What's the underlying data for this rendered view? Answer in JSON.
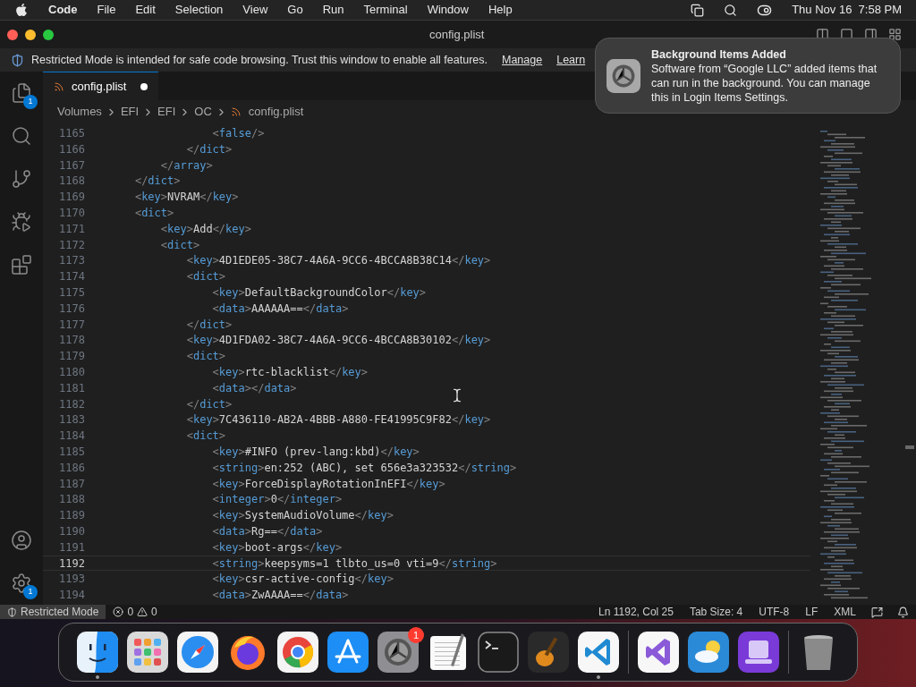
{
  "menu_bar": {
    "app": "Code",
    "items": [
      "File",
      "Edit",
      "Selection",
      "View",
      "Go",
      "Run",
      "Terminal",
      "Window",
      "Help"
    ],
    "clock": "Thu Nov 16  7:58 PM"
  },
  "window": {
    "title": "config.plist"
  },
  "banner": {
    "message": "Restricted Mode is intended for safe code browsing. Trust this window to enable all features.",
    "links": [
      "Manage",
      "Learn"
    ]
  },
  "activity_bar": {
    "top": [
      {
        "kind": "explorer",
        "badge": "1"
      },
      {
        "kind": "search"
      },
      {
        "kind": "scm"
      },
      {
        "kind": "debug"
      },
      {
        "kind": "extensions"
      }
    ],
    "bottom": [
      {
        "kind": "accounts"
      },
      {
        "kind": "manage",
        "badge": "1"
      }
    ]
  },
  "tabs": [
    {
      "label": "config.plist",
      "selected": true,
      "modified": true
    }
  ],
  "breadcrumb": [
    "Volumes",
    "EFI",
    "EFI",
    "OC",
    "config.plist"
  ],
  "editor": {
    "lines": [
      {
        "number": "1165",
        "text": "                <false/>",
        "current": false
      },
      {
        "number": "1166",
        "text": "            </dict>",
        "current": false
      },
      {
        "number": "1167",
        "text": "        </array>",
        "current": false
      },
      {
        "number": "1168",
        "text": "    </dict>",
        "current": false
      },
      {
        "number": "1169",
        "text": "    <key>NVRAM</key>",
        "current": false
      },
      {
        "number": "1170",
        "text": "    <dict>",
        "current": false
      },
      {
        "number": "1171",
        "text": "        <key>Add</key>",
        "current": false
      },
      {
        "number": "1172",
        "text": "        <dict>",
        "current": false
      },
      {
        "number": "1173",
        "text": "            <key>4D1EDE05-38C7-4A6A-9CC6-4BCCA8B38C14</key>",
        "current": false
      },
      {
        "number": "1174",
        "text": "            <dict>",
        "current": false
      },
      {
        "number": "1175",
        "text": "                <key>DefaultBackgroundColor</key>",
        "current": false
      },
      {
        "number": "1176",
        "text": "                <data>AAAAAA==</data>",
        "current": false
      },
      {
        "number": "1177",
        "text": "            </dict>",
        "current": false
      },
      {
        "number": "1178",
        "text": "            <key>4D1FDA02-38C7-4A6A-9CC6-4BCCA8B30102</key>",
        "current": false
      },
      {
        "number": "1179",
        "text": "            <dict>",
        "current": false
      },
      {
        "number": "1180",
        "text": "                <key>rtc-blacklist</key>",
        "current": false
      },
      {
        "number": "1181",
        "text": "                <data></data>",
        "current": false
      },
      {
        "number": "1182",
        "text": "            </dict>",
        "current": false
      },
      {
        "number": "1183",
        "text": "            <key>7C436110-AB2A-4BBB-A880-FE41995C9F82</key>",
        "current": false
      },
      {
        "number": "1184",
        "text": "            <dict>",
        "current": false
      },
      {
        "number": "1185",
        "text": "                <key>#INFO (prev-lang:kbd)</key>",
        "current": false
      },
      {
        "number": "1186",
        "text": "                <string>en:252 (ABC), set 656e3a323532</string>",
        "current": false
      },
      {
        "number": "1187",
        "text": "                <key>ForceDisplayRotationInEFI</key>",
        "current": false
      },
      {
        "number": "1188",
        "text": "                <integer>0</integer>",
        "current": false
      },
      {
        "number": "1189",
        "text": "                <key>SystemAudioVolume</key>",
        "current": false
      },
      {
        "number": "1190",
        "text": "                <data>Rg==</data>",
        "current": false
      },
      {
        "number": "1191",
        "text": "                <key>boot-args</key>",
        "current": false
      },
      {
        "number": "1192",
        "text": "                <string>keepsyms=1 tlbto_us=0 vti=9</string>",
        "current": true
      },
      {
        "number": "1193",
        "text": "                <key>csr-active-config</key>",
        "current": false
      },
      {
        "number": "1194",
        "text": "                <data>ZwAAAA==</data>",
        "current": false
      }
    ]
  },
  "status_bar": {
    "mode": "Restricted Mode",
    "errors": "0",
    "warnings": "0",
    "right": [
      "Ln 1192, Col 25",
      "Tab Size: 4",
      "UTF-8",
      "LF",
      "XML"
    ]
  },
  "notification": {
    "title": "Background Items Added",
    "body": "Software from “Google LLC” added items that can run in the background. You can manage this in Login Items Settings."
  },
  "dock": {
    "apps": [
      {
        "kind": "finder",
        "running": true
      },
      {
        "kind": "launchpad",
        "running": false
      },
      {
        "kind": "safari",
        "running": false
      },
      {
        "kind": "firefox",
        "running": false
      },
      {
        "kind": "chrome",
        "running": false
      },
      {
        "kind": "appstore",
        "running": false
      },
      {
        "kind": "settings",
        "running": false,
        "badge": "1"
      },
      {
        "kind": "textedit",
        "running": false
      },
      {
        "kind": "terminal",
        "running": false
      },
      {
        "kind": "garageband",
        "running": false
      },
      {
        "kind": "vscode",
        "running": true
      },
      {
        "kind": "separator"
      },
      {
        "kind": "visualstudio",
        "running": false
      },
      {
        "kind": "weather",
        "running": false
      },
      {
        "kind": "configurator",
        "running": false
      },
      {
        "kind": "separator"
      },
      {
        "kind": "trash",
        "running": false
      }
    ]
  }
}
